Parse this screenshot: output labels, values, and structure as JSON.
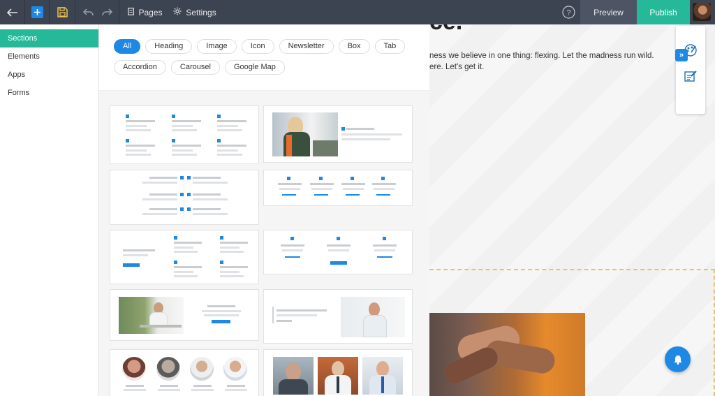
{
  "topbar": {
    "pages_label": "Pages",
    "settings_label": "Settings",
    "preview_label": "Preview",
    "publish_label": "Publish"
  },
  "leftnav": {
    "items": [
      {
        "label": "Sections",
        "active": true
      },
      {
        "label": "Elements",
        "active": false
      },
      {
        "label": "Apps",
        "active": false
      },
      {
        "label": "Forms",
        "active": false
      }
    ]
  },
  "filters": [
    "All",
    "Heading",
    "Image",
    "Icon",
    "Newsletter",
    "Box",
    "Tab",
    "Accordion",
    "Carousel",
    "Google Map"
  ],
  "canvas": {
    "hero_title_fragment": "ce.",
    "hero_text_line1": "ness we believe in one thing: flexing. Let the madness run wild.",
    "hero_text_line2": "ere. Let's get it."
  },
  "colors": {
    "accent_green": "#25b99a",
    "accent_blue": "#1e88e5",
    "topbar": "#3c4451"
  }
}
